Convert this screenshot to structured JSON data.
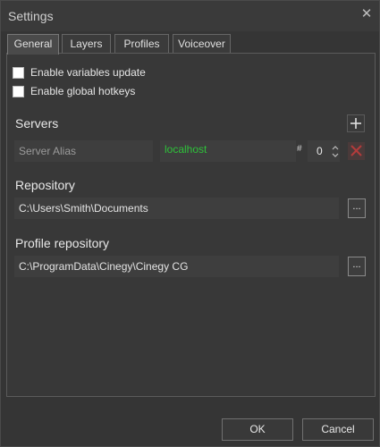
{
  "window": {
    "title": "Settings"
  },
  "tabs": [
    {
      "label": "General",
      "active": true
    },
    {
      "label": "Layers",
      "active": false
    },
    {
      "label": "Profiles",
      "active": false
    },
    {
      "label": "Voiceover",
      "active": false
    }
  ],
  "general": {
    "checkboxes": [
      {
        "label": "Enable variables update",
        "checked": false
      },
      {
        "label": "Enable global hotkeys",
        "checked": false
      }
    ],
    "servers": {
      "title": "Servers",
      "alias_placeholder": "Server Alias",
      "host": "localhost",
      "hash": "#",
      "port": "0"
    },
    "repository": {
      "title": "Repository",
      "path": "C:\\Users\\Smith\\Documents",
      "browse_label": "..."
    },
    "profile_repository": {
      "title": "Profile repository",
      "path": "C:\\ProgramData\\Cinegy\\Cinegy CG",
      "browse_label": "..."
    }
  },
  "footer": {
    "ok_label": "OK",
    "cancel_label": "Cancel"
  },
  "colors": {
    "host_text": "#2ec23a",
    "delete_icon": "#b23b3b",
    "background": "#353535"
  },
  "icons": {
    "close": "close-icon",
    "add": "plus-icon",
    "remove": "delete-x-icon"
  }
}
